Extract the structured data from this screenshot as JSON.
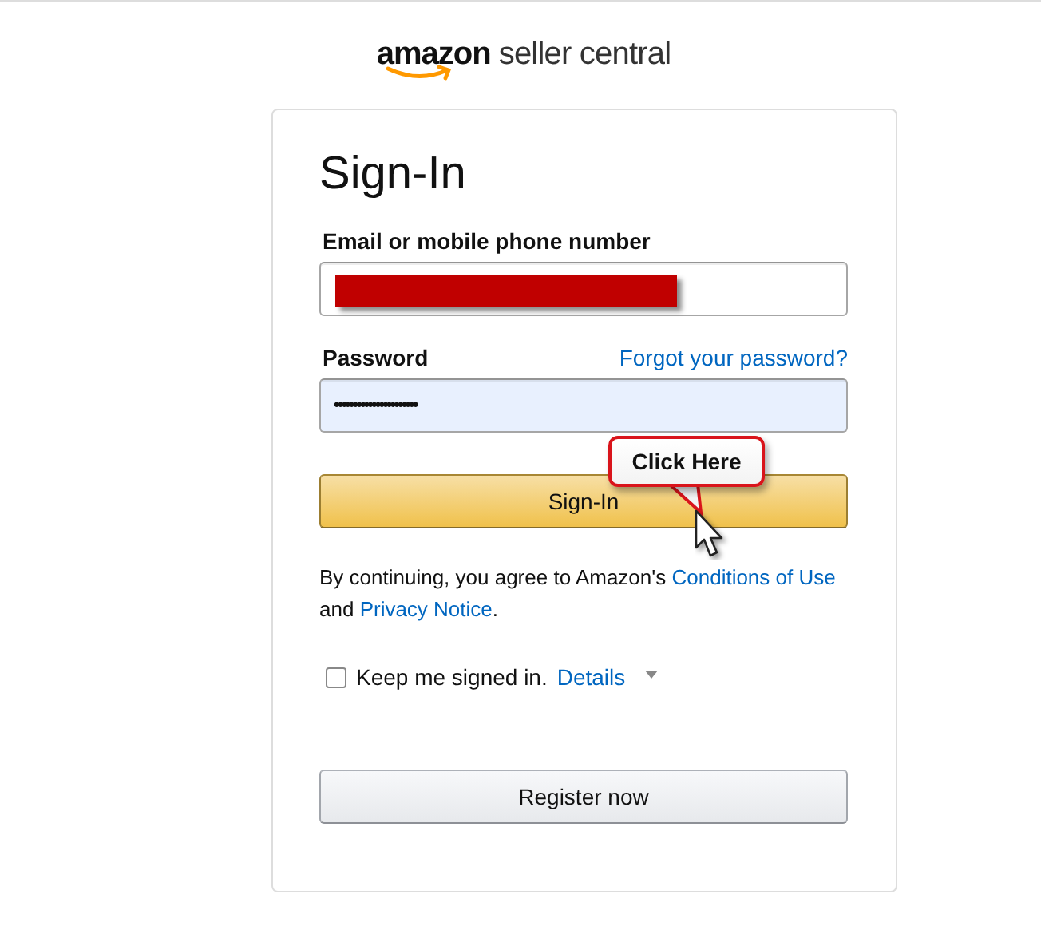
{
  "logo": {
    "brand": "amazon",
    "product": "seller central"
  },
  "form": {
    "title": "Sign-In",
    "email": {
      "label": "Email or mobile phone number",
      "redacted": true
    },
    "password": {
      "label": "Password",
      "forgot_link": "Forgot your password?",
      "value": "••••••••••••••••••••••"
    },
    "sign_in_button": "Sign-In",
    "callout": "Click Here",
    "legal": {
      "text": "By continuing, you agree to Amazon's ",
      "link1": "Conditions of Use",
      "middle": " and ",
      "link2": "Privacy Notice",
      "end": "."
    },
    "keep_signed_in": {
      "label": "Keep me signed in.",
      "checked": false,
      "details_link": "Details"
    },
    "register_button": "Register now"
  }
}
